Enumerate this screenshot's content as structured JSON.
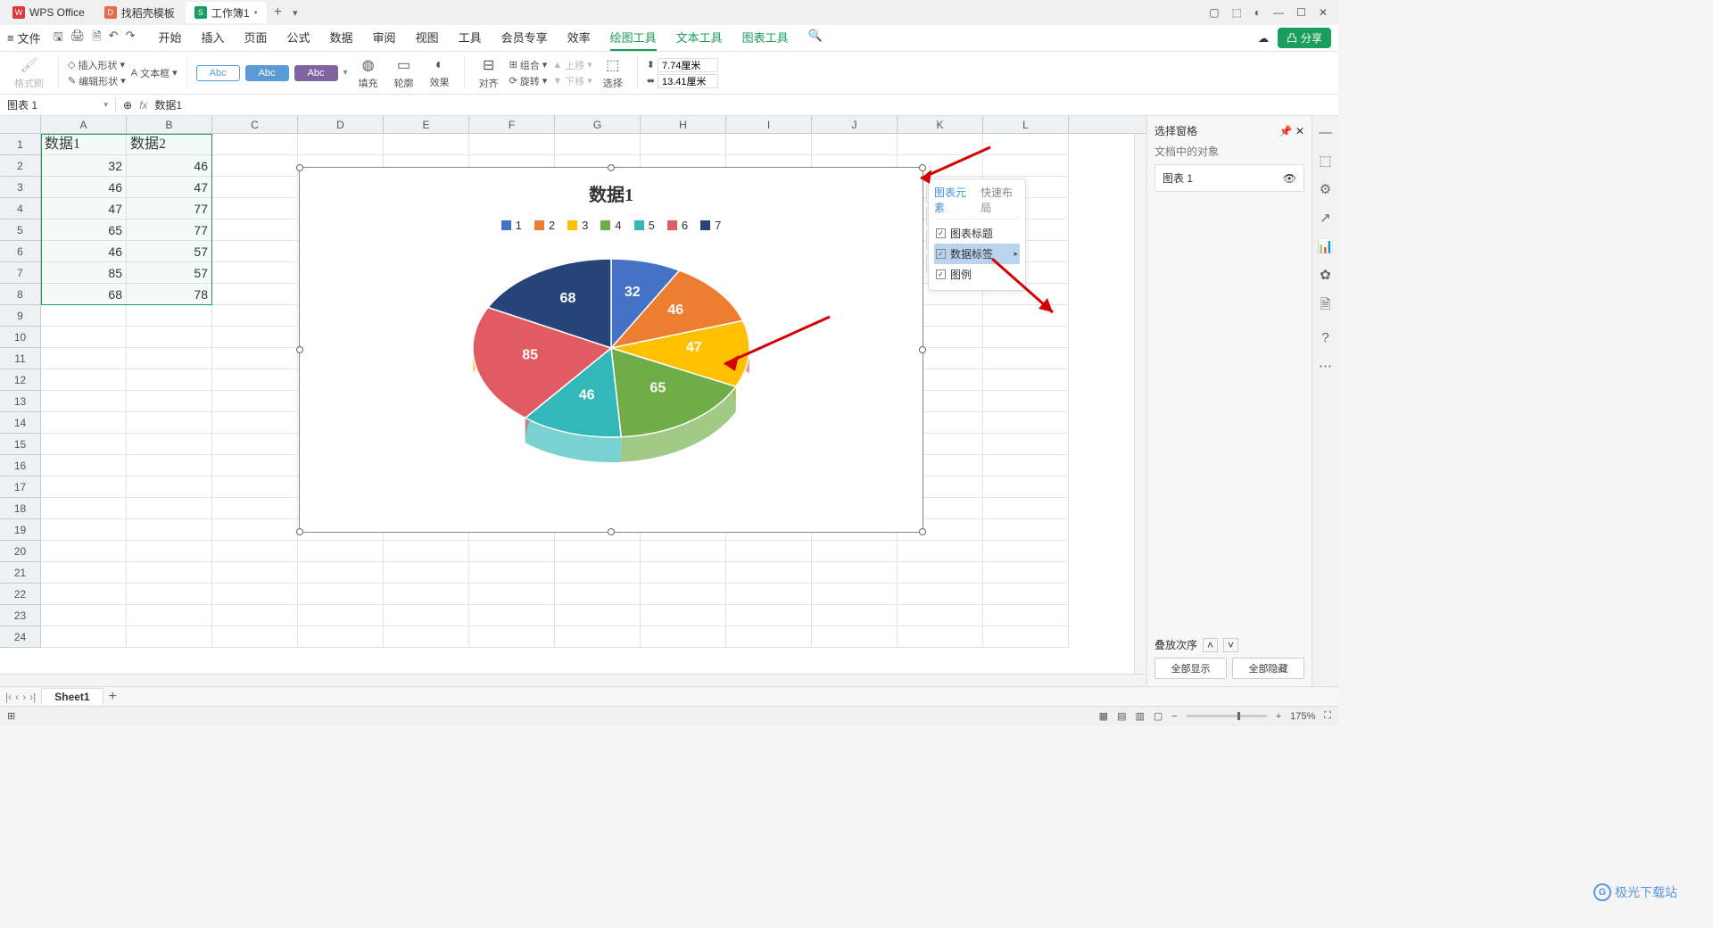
{
  "tabs": {
    "app": "WPS Office",
    "template": "找稻壳模板",
    "workbook": "工作簿1"
  },
  "file_label": "文件",
  "menus": [
    "开始",
    "插入",
    "页面",
    "公式",
    "数据",
    "审阅",
    "视图",
    "工具",
    "会员专享",
    "效率",
    "绘图工具",
    "文本工具",
    "图表工具"
  ],
  "active_menu": "绘图工具",
  "share": "分享",
  "ribbon": {
    "format_painter": "格式刷",
    "insert_shape": "插入形状",
    "text_box": "文本框",
    "edit_shape": "编辑形状",
    "style_label": "Abc",
    "fill": "填充",
    "outline": "轮廓",
    "effect": "效果",
    "align": "对齐",
    "group": "组合",
    "rotate": "旋转",
    "up": "上移",
    "down": "下移",
    "select": "选择",
    "width": "7.74厘米",
    "height": "13.41厘米"
  },
  "name_box": "图表 1",
  "formula": "数据1",
  "cols": [
    "A",
    "B",
    "C",
    "D",
    "E",
    "F",
    "G",
    "H",
    "I",
    "J",
    "K",
    "L"
  ],
  "grid": {
    "headers": [
      "数据1",
      "数据2"
    ],
    "rows": [
      [
        32,
        46
      ],
      [
        46,
        47
      ],
      [
        47,
        77
      ],
      [
        65,
        77
      ],
      [
        46,
        57
      ],
      [
        85,
        57
      ],
      [
        68,
        78
      ]
    ]
  },
  "chart_data": {
    "type": "pie",
    "title": "数据1",
    "categories": [
      "1",
      "2",
      "3",
      "4",
      "5",
      "6",
      "7"
    ],
    "values": [
      32,
      46,
      47,
      65,
      46,
      85,
      68
    ],
    "colors": [
      "#4472c4",
      "#ed7d31",
      "#ffc000",
      "#70ad47",
      "#32b8b8",
      "#e15b64",
      "#264478"
    ]
  },
  "float_tabs": {
    "elements": "图表元素",
    "layout": "快速布局"
  },
  "float_items": {
    "title": "图表标题",
    "labels": "数据标签",
    "legend": "图例"
  },
  "sel_pane": {
    "title": "选择窗格",
    "sub": "文档中的对象",
    "item": "图表 1",
    "order": "叠放次序",
    "show_all": "全部显示",
    "hide_all": "全部隐藏"
  },
  "sheet_tab": "Sheet1",
  "zoom": "175%",
  "watermark": "极光下载站"
}
